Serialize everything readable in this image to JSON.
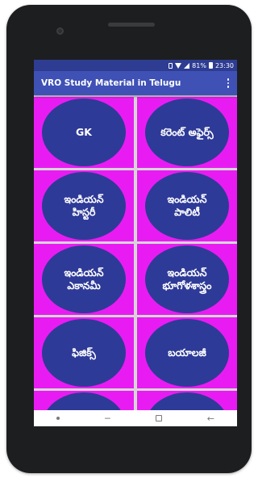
{
  "status_bar": {
    "battery_percent": "81%",
    "time": "23:30",
    "icons": [
      "sim-icon",
      "wifi-icon",
      "signal-icon",
      "battery-icon"
    ]
  },
  "app_bar": {
    "title": "VRO Study Material in Telugu",
    "menu_icon": "more-vert-icon"
  },
  "tiles": [
    {
      "line1": "GK",
      "line2": ""
    },
    {
      "line1": "కరెంట్ అఫైర్స్",
      "line2": ""
    },
    {
      "line1": "ఇండియన్",
      "line2": "హిస్టరీ"
    },
    {
      "line1": "ఇండియన్",
      "line2": "పాలిటీ"
    },
    {
      "line1": "ఇండియన్",
      "line2": "ఎకానమీ"
    },
    {
      "line1": "ఇండియన్",
      "line2": "భూగోళశాస్త్రం"
    },
    {
      "line1": "ఫిజిక్స్",
      "line2": ""
    },
    {
      "line1": "బయాలజీ",
      "line2": ""
    },
    {
      "line1": "",
      "line2": ""
    },
    {
      "line1": "",
      "line2": ""
    }
  ],
  "colors": {
    "status_bar": "#2e3d92",
    "app_bar": "#3f51b5",
    "tile_background": "#e81cf2",
    "circle": "#2e3a97"
  },
  "nav_bar": {
    "icons": [
      "nav-dot-icon",
      "recents-icon",
      "home-icon",
      "back-icon"
    ]
  }
}
